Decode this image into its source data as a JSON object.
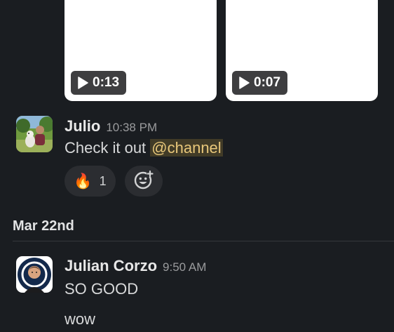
{
  "videos": [
    {
      "duration": "0:13"
    },
    {
      "duration": "0:07"
    }
  ],
  "message_julio": {
    "author": "Julio",
    "time": "10:38 PM",
    "text": "Check it out ",
    "mention": "@channel",
    "reactions": [
      {
        "emoji": "🔥",
        "emoji_name": "fire-emoji",
        "count": "1"
      }
    ],
    "add_reaction_icon": "add-reaction-icon"
  },
  "date_divider": {
    "label": "Mar 22nd"
  },
  "message_julian": {
    "author": "Julian Corzo",
    "time": "9:50 AM",
    "lines": [
      "SO GOOD",
      "wow"
    ]
  },
  "colors": {
    "background": "#1a1d21",
    "mention_highlight": "#e8c77a",
    "reaction_bg": "#2b2d31"
  }
}
